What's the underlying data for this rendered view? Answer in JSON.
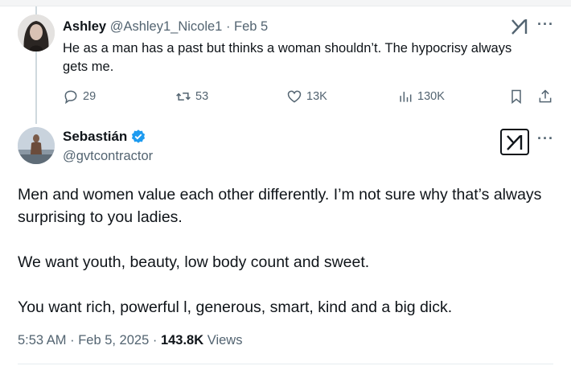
{
  "reply": {
    "name": "Ashley",
    "handle": "@Ashley1_Nicole1",
    "separator": " · ",
    "date": "Feb 5",
    "text": "He as a man has a past but thinks a woman shouldn’t.  The hypocrisy always gets me.",
    "replies": "29",
    "reposts": "53",
    "likes": "13K",
    "views": "130K"
  },
  "main": {
    "name": "Sebastián",
    "handle": "@gvtcontractor",
    "paragraphs": [
      "Men and women value each other differently. I’m not sure why that’s always surprising to you ladies.",
      "We want youth, beauty, low body count and sweet.",
      "You want rich, powerful l, generous, smart, kind and a big dick."
    ],
    "time": "5:53 AM · Feb 5, 2025 · ",
    "views_count": "143.8K",
    "views_label": " Views"
  },
  "icons": {
    "reply": "speech-bubble-icon",
    "repost": "repost-arrows-icon",
    "like": "heart-icon",
    "views": "bar-chart-icon",
    "bookmark": "bookmark-icon",
    "share": "share-icon",
    "grok": "grok-icon",
    "more": "more-dots-icon",
    "verified": "verified-badge-icon"
  },
  "colors": {
    "text": "#0f1419",
    "muted": "#536471",
    "verified": "#1d9bf0"
  }
}
